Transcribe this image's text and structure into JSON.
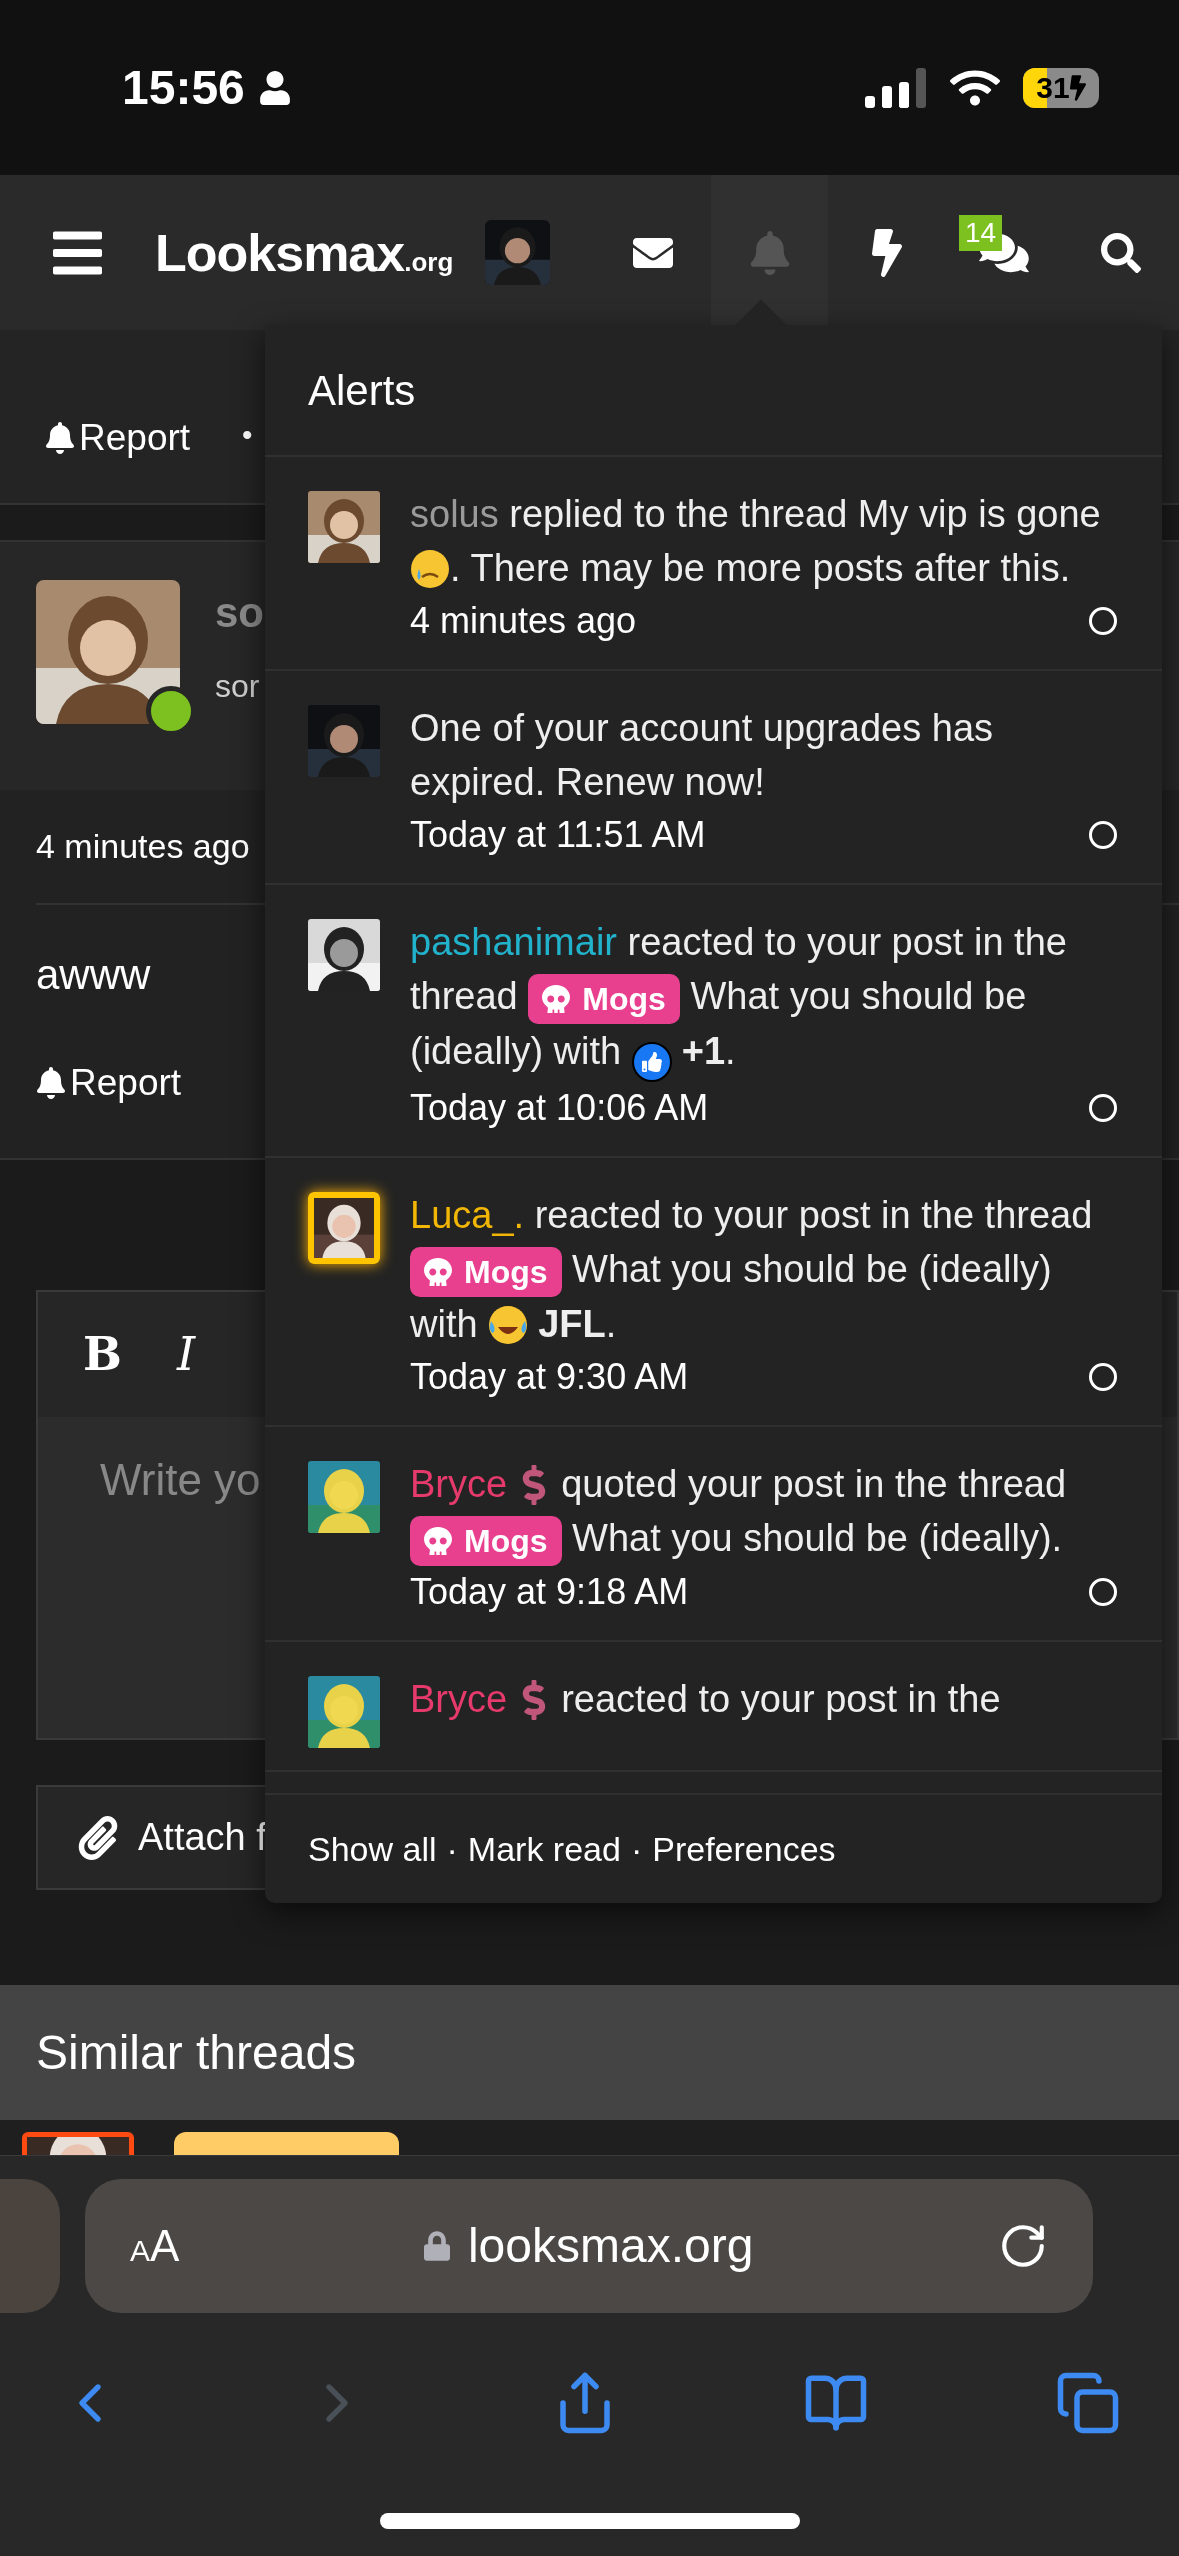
{
  "status_bar": {
    "time": "15:56",
    "battery": "31"
  },
  "nav": {
    "logo": {
      "name": "Looksmax",
      "suffix": ".org"
    },
    "icons": [
      {
        "kind": "mail",
        "selected": false
      },
      {
        "kind": "alerts",
        "selected": true
      },
      {
        "kind": "whats_new",
        "selected": false
      },
      {
        "kind": "conversations",
        "selected": false,
        "badge": "14"
      },
      {
        "kind": "search",
        "selected": false
      }
    ]
  },
  "thread": {
    "report": "Report",
    "bullet": "•",
    "post": {
      "online": true,
      "username": "so",
      "user_title": "sor",
      "time": "4 minutes ago",
      "body": "awww",
      "report": "Report"
    },
    "editor": {
      "bold": "B",
      "italic": "I",
      "placeholder": "Write yo",
      "attach": "Attach f"
    },
    "similar_threads": {
      "title": "Similar threads"
    }
  },
  "alerts_menu": {
    "title": "Alerts",
    "alerts": [
      {
        "avatar": {
          "kind": "picture",
          "glow": false
        },
        "segments": [
          {
            "kind": "user",
            "text": "solus",
            "color": "#9a9a9a"
          },
          {
            "kind": "text",
            "text": " replied to the thread My vip is gone "
          },
          {
            "kind": "emoji",
            "icon": {
              "kind": "cry"
            }
          },
          {
            "kind": "text",
            "text": ". There may be more posts after this."
          }
        ],
        "time": "4 minutes ago"
      },
      {
        "avatar": {
          "kind": "picture",
          "glow": false
        },
        "segments": [
          {
            "kind": "text",
            "text": "One of your account upgrades has expired. Renew now!"
          }
        ],
        "time": "Today at 11:51 AM"
      },
      {
        "avatar": {
          "kind": "picture",
          "glow": false
        },
        "segments": [
          {
            "kind": "user",
            "text": "pashanimair",
            "color": "#22b3cc"
          },
          {
            "kind": "text",
            "text": " reacted to your post in the thread "
          },
          {
            "kind": "tag",
            "text": "Mogs"
          },
          {
            "kind": "text",
            "text": " What you should be (ideally) with "
          },
          {
            "kind": "reaction",
            "icon": {
              "kind": "like"
            },
            "text": "+1"
          },
          {
            "kind": "text",
            "text": "."
          }
        ],
        "time": "Today at 10:06 AM"
      },
      {
        "avatar": {
          "kind": "picture",
          "glow": true
        },
        "segments": [
          {
            "kind": "user",
            "text": "Luca_.",
            "color": "#f2b705"
          },
          {
            "kind": "text",
            "text": " reacted to your post in the thread "
          },
          {
            "kind": "tag",
            "text": "Mogs"
          },
          {
            "kind": "text",
            "text": " What you should be (ideally) with "
          },
          {
            "kind": "reaction",
            "icon": {
              "kind": "laugh"
            },
            "text": "JFL"
          },
          {
            "kind": "text",
            "text": "."
          }
        ],
        "time": "Today at 9:30 AM"
      },
      {
        "avatar": {
          "kind": "picture",
          "glow": false
        },
        "segments": [
          {
            "kind": "user",
            "text": "Bryce",
            "color": "#e63a6c"
          },
          {
            "kind": "user_badge"
          },
          {
            "kind": "text",
            "text": "quoted your post in the thread "
          },
          {
            "kind": "tag",
            "text": "Mogs"
          },
          {
            "kind": "text",
            "text": " What you should be (ideally)."
          }
        ],
        "time": "Today at 9:18 AM"
      },
      {
        "avatar": {
          "kind": "picture",
          "glow": false
        },
        "segments": [
          {
            "kind": "user",
            "text": "Bryce",
            "color": "#e63a6c"
          },
          {
            "kind": "user_badge"
          },
          {
            "kind": "text",
            "text": "reacted to your post in the"
          }
        ]
      }
    ],
    "footer": {
      "links": [
        "Show all",
        "Mark read",
        "Preferences"
      ],
      "separator": "·"
    }
  },
  "browser": {
    "text_size": "AA",
    "url": "looksmax.org"
  }
}
